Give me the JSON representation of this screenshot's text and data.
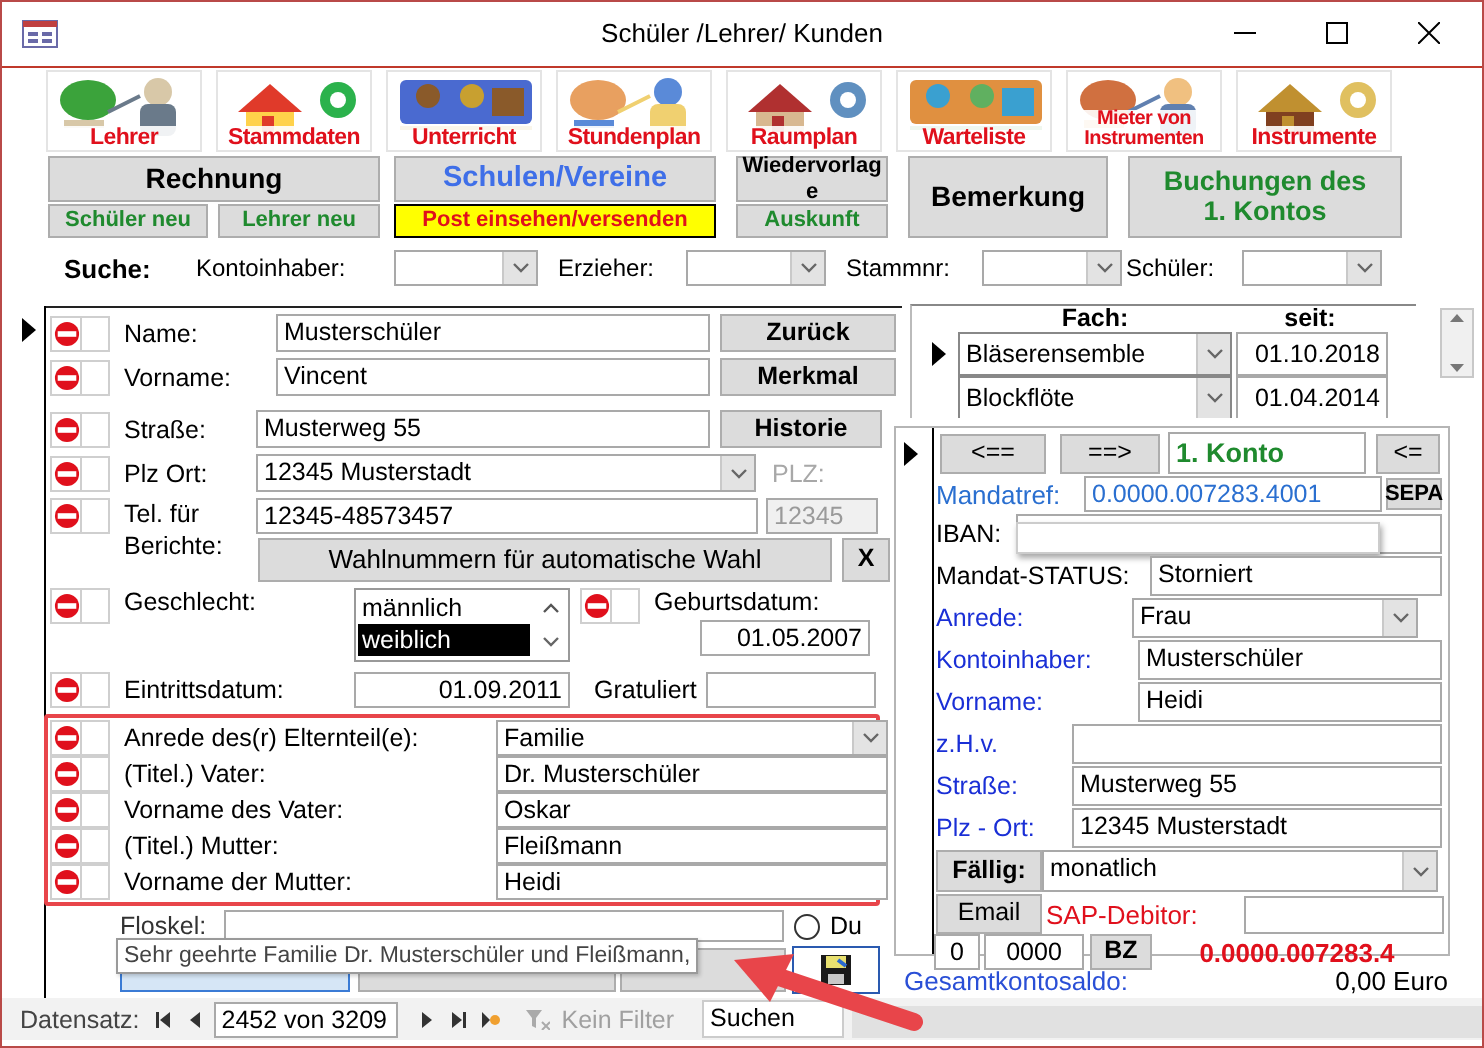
{
  "window": {
    "title": "Schüler /Lehrer/ Kunden"
  },
  "tiles": [
    {
      "label": "Lehrer"
    },
    {
      "label": "Stammdaten"
    },
    {
      "label": "Unterricht"
    },
    {
      "label": "Stundenplan"
    },
    {
      "label": "Raumplan"
    },
    {
      "label": "Warteliste"
    },
    {
      "label": "Mieter von Instrumenten"
    },
    {
      "label": "Instrumente"
    }
  ],
  "menu_buttons": [
    {
      "label": "Rechnung",
      "kind": "plain"
    },
    {
      "label": "Schüler neu",
      "kind": "green"
    },
    {
      "label": "Lehrer neu",
      "kind": "green"
    },
    {
      "label": "Schulen/Vereine",
      "kind": "link"
    },
    {
      "label": "Post einsehen/versenden",
      "kind": "alert"
    },
    {
      "label": "Wiedervorlage",
      "kind": "plain"
    },
    {
      "label": "Auskunft",
      "kind": "green"
    },
    {
      "label": "Bemerkung",
      "kind": "plain"
    },
    {
      "label": "Buchungen des 1. Kontos",
      "kind": "green"
    }
  ],
  "search": {
    "label": "Suche:",
    "filters": [
      {
        "label": "Kontoinhaber:"
      },
      {
        "label": "Erzieher:"
      },
      {
        "label": "Stammnr:"
      },
      {
        "label": "Schüler:"
      }
    ]
  },
  "person": {
    "name": {
      "label": "Name:",
      "value": "Musterschüler",
      "checked": false
    },
    "first_name": {
      "label": "Vorname:",
      "value": "Vincent",
      "checked": false
    },
    "street": {
      "label": "Straße:",
      "value": "Musterweg 55",
      "checked": false
    },
    "city": {
      "label": "Plz Ort:",
      "value": "12345 Musterstadt",
      "checked": false
    },
    "zip": {
      "label": "PLZ:",
      "value": "12345",
      "disabled": true
    },
    "phone": {
      "label": "Tel. für Berichte:",
      "value": "12345-48573457",
      "checked": false
    },
    "gender": {
      "label": "Geschlecht:",
      "checked": false,
      "options": [
        {
          "label": "männlich",
          "selected": false
        },
        {
          "label": "weiblich",
          "selected": true
        }
      ]
    },
    "birth_date": {
      "label": "Geburtsdatum:",
      "value": "01.05.2007",
      "checked": false
    },
    "entry_date": {
      "label": "Eintrittsdatum:",
      "value": "01.09.2011",
      "checked": false
    },
    "congratulated": {
      "label": "Gratuliert"
    }
  },
  "side_buttons": [
    "Zurück",
    "Merkmal",
    "Historie"
  ],
  "dial_button": "Wahlnummern für automatische Wahl",
  "clear_button": "X",
  "parents": [
    {
      "label": "Anrede des(r) Elternteil(e):",
      "value": "Familie",
      "kind": "combo",
      "checked": false
    },
    {
      "label": "(Titel.) Vater:",
      "value": "Dr. Musterschüler",
      "kind": "text",
      "checked": false
    },
    {
      "label": "Vorname des Vater:",
      "value": "Oskar",
      "kind": "text",
      "checked": false
    },
    {
      "label": "(Titel.) Mutter:",
      "value": "Fleißmann",
      "kind": "text",
      "checked": false
    },
    {
      "label": "Vorname der Mutter:",
      "value": "Heidi",
      "kind": "text",
      "checked": false
    }
  ],
  "floskel": {
    "label": "Floskel:",
    "radio": {
      "label": "Du",
      "selected": false
    }
  },
  "tooltip": "Sehr geehrte Familie Dr. Musterschüler und Fleißmann,",
  "subjects": {
    "columns": [
      "Fach:",
      "seit:"
    ],
    "rows": [
      {
        "subject": "Bläserensemble",
        "since": "01.10.2018",
        "selected": true
      },
      {
        "subject": "Blockflöte",
        "since": "01.04.2014",
        "selected": false
      }
    ]
  },
  "account": {
    "prev": "<==",
    "next": "==>",
    "title": "1. Konto",
    "back": "<=",
    "mandate": {
      "label": "Mandatref:",
      "value": "0.0000.007283.4001"
    },
    "sepa": "SEPA",
    "fields": [
      {
        "label": "IBAN:",
        "kind": "text"
      },
      {
        "label": "Mandat-STATUS:",
        "value": "Storniert",
        "kind": "text"
      },
      {
        "label": "Anrede:",
        "value": "Frau",
        "kind": "combo"
      },
      {
        "label": "Kontoinhaber:",
        "value": "Musterschüler",
        "kind": "text"
      },
      {
        "label": "Vorname:",
        "value": "Heidi",
        "kind": "text"
      },
      {
        "label": "z.H.v.",
        "kind": "text"
      },
      {
        "label": "Straße:",
        "value": "Musterweg 55",
        "kind": "text"
      },
      {
        "label": "Plz - Ort:",
        "value": "12345 Musterstadt",
        "kind": "text"
      }
    ],
    "due": {
      "button": "Fällig:",
      "value": "monatlich"
    },
    "email_button": "Email",
    "sap_label": "SAP-Debitor:",
    "codes": [
      "0",
      "0000"
    ],
    "bz_button": "BZ",
    "reference": "0.0000.007283.4"
  },
  "balance": {
    "label": "Gesamtkontosaldo:",
    "value": "0,00 Euro"
  },
  "status_bar": {
    "label": "Datensatz:",
    "record": "2452 von 3209",
    "filter": "Kein Filter",
    "search": "Suchen"
  }
}
